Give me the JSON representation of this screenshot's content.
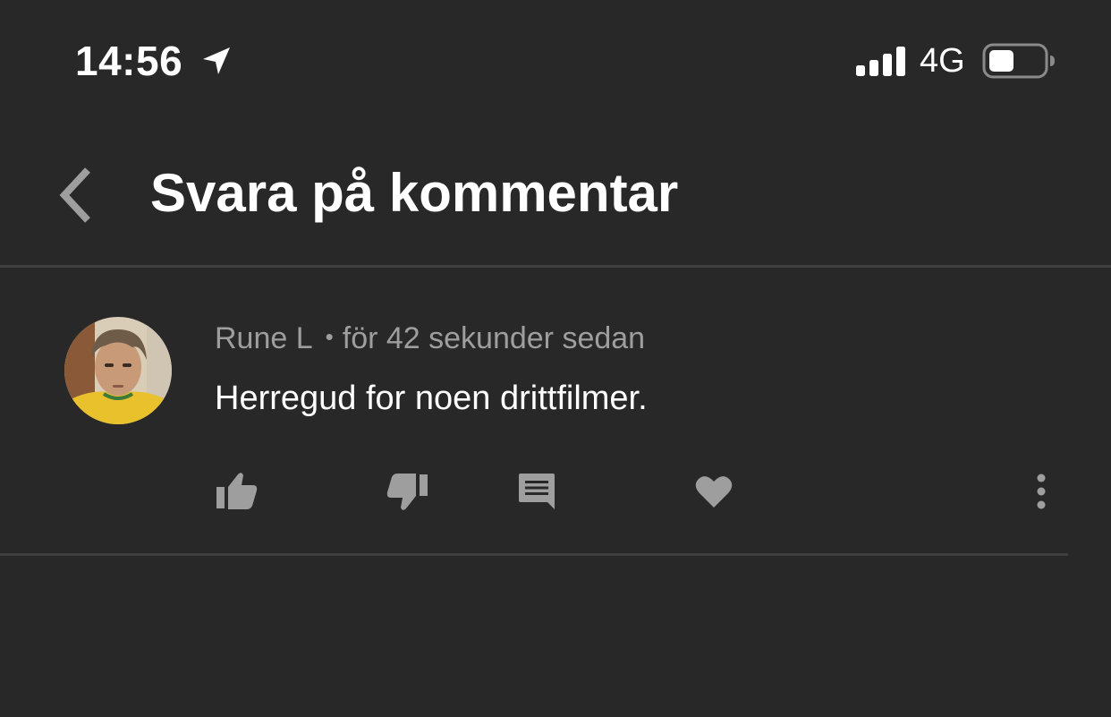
{
  "status_bar": {
    "time": "14:56",
    "network": "4G",
    "icons": [
      "location-arrow-icon",
      "signal-bars-icon",
      "battery-icon"
    ]
  },
  "header": {
    "title": "Svara på kommentar",
    "back_icon": "chevron-left-icon"
  },
  "comment": {
    "author": "Rune L",
    "separator": "•",
    "timestamp": "för 42 sekunder sedan",
    "text": "Herregud for noen drittfilmer.",
    "actions": [
      "thumbs-up-icon",
      "thumbs-down-icon",
      "comment-icon",
      "heart-icon",
      "more-vertical-icon"
    ]
  },
  "colors": {
    "background": "#282828",
    "divider": "#3f3f3f",
    "primary_text": "#ffffff",
    "secondary_text": "#9e9e9e",
    "icon": "#9e9e9e"
  }
}
